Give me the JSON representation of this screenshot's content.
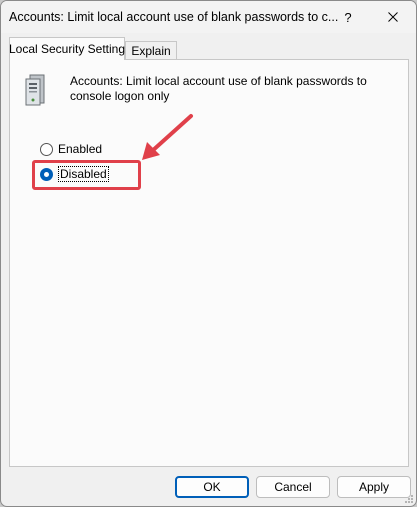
{
  "window": {
    "title": "Accounts: Limit local account use of blank passwords to c...",
    "help_glyph": "?",
    "close_icon": "close-icon"
  },
  "tabs": [
    {
      "label": "Local Security Setting",
      "active": true
    },
    {
      "label": "Explain",
      "active": false
    }
  ],
  "policy": {
    "icon": "computer-tower-icon",
    "name": "Accounts: Limit local account use of blank passwords to console logon only"
  },
  "options": [
    {
      "label": "Enabled",
      "selected": false
    },
    {
      "label": "Disabled",
      "selected": true
    }
  ],
  "buttons": {
    "ok": "OK",
    "cancel": "Cancel",
    "apply": "Apply"
  },
  "colors": {
    "accent": "#005fb8",
    "annotation": "#e0404a"
  }
}
